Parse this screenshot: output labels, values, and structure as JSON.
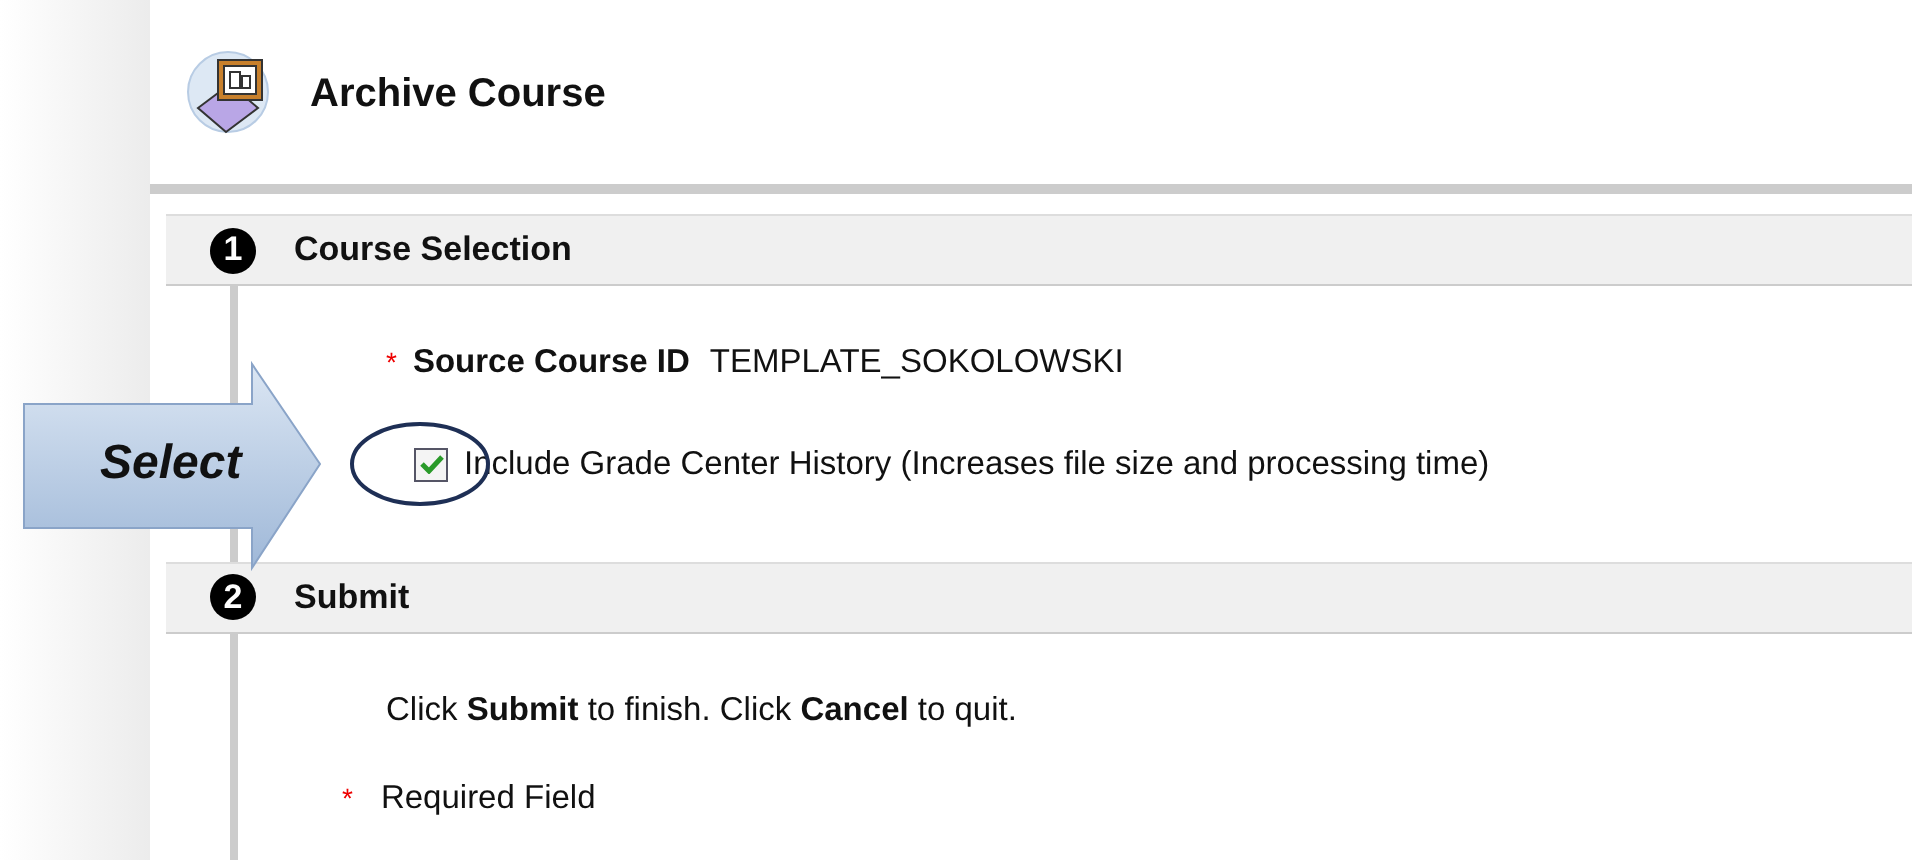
{
  "page": {
    "title": "Archive Course"
  },
  "sections": [
    {
      "number": "1",
      "title": "Course Selection",
      "fields": [
        {
          "kind": "value",
          "required_marker": "*",
          "label": "Source Course ID",
          "value": "TEMPLATE_SOKOLOWSKI"
        },
        {
          "kind": "checkbox",
          "checked": true,
          "label": "Include Grade Center History (Increases file size and processing time)"
        }
      ]
    },
    {
      "number": "2",
      "title": "Submit",
      "instructions": "Click **Submit** to finish. Click **Cancel** to quit.",
      "required_note": {
        "marker": "*",
        "text": "Required Field"
      }
    }
  ],
  "callout": {
    "label": "Select"
  }
}
